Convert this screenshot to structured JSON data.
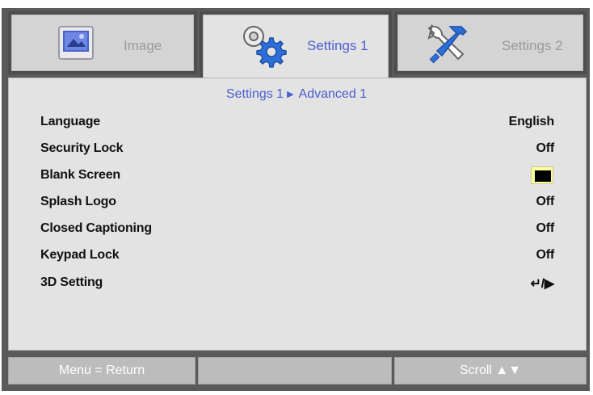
{
  "tabs": [
    {
      "label": "Image",
      "icon": "image-icon",
      "active": false
    },
    {
      "label": "Settings 1",
      "icon": "gears-icon",
      "active": true
    },
    {
      "label": "Settings 2",
      "icon": "tools-icon",
      "active": false
    }
  ],
  "breadcrumb": {
    "parent": "Settings 1",
    "child": "Advanced 1"
  },
  "menu": [
    {
      "label": "Language",
      "value": "English"
    },
    {
      "label": "Security Lock",
      "value": "Off"
    },
    {
      "label": "Blank Screen",
      "value": ""
    },
    {
      "label": "Splash Logo",
      "value": "Off"
    },
    {
      "label": "Closed Captioning",
      "value": "Off"
    },
    {
      "label": "Keypad Lock",
      "value": "Off"
    },
    {
      "label": "3D Setting",
      "value": "↵/▶"
    }
  ],
  "footer": {
    "left": "Menu = Return",
    "middle": "",
    "right": "Scroll ▲▼"
  },
  "colors": {
    "accent": "#4a5fd0",
    "frame": "#5a5a5a",
    "panel": "#e3e3e3",
    "blank_screen_swatch": "#000000"
  }
}
